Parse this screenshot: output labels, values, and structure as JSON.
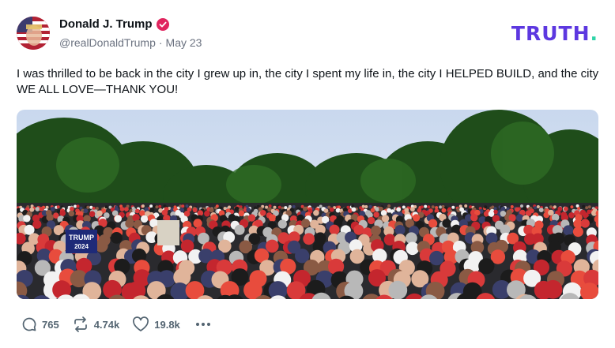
{
  "post": {
    "author_name": "Donald J. Trump",
    "handle": "@realDonaldTrump",
    "separator": "·",
    "date": "May 23",
    "text": "I was thrilled to be back in the city I grew up in, the city I spent my life in, the city I HELPED BUILD, and the city WE ALL LOVE—THANK YOU!",
    "image_sign_text": "TRUMP 2024"
  },
  "brand": {
    "logo_text": "TRUTH",
    "logo_dot": ".",
    "color_primary": "#5d38e0",
    "color_dot": "#2fd4a8"
  },
  "actions": {
    "replies": "765",
    "retruths": "4.74k",
    "likes": "19.8k"
  },
  "icons": [
    "verified-badge-icon",
    "reply-icon",
    "retruth-icon",
    "like-icon",
    "more-icon"
  ]
}
